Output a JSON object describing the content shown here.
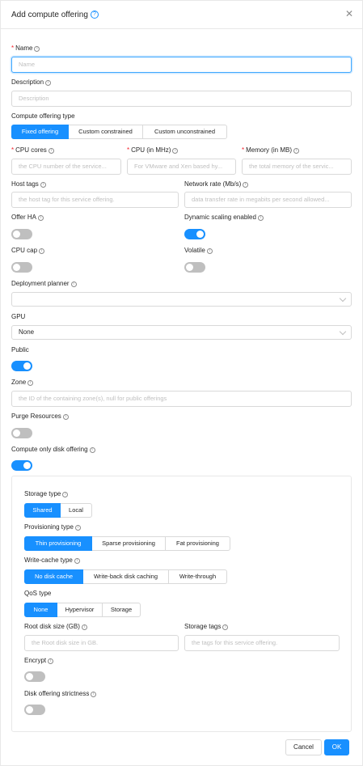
{
  "dialog": {
    "title": "Add compute offering",
    "help_icon": "question-circle-icon",
    "close_icon": "close-icon"
  },
  "fields": {
    "name": {
      "label": "Name",
      "placeholder": "Name",
      "required": true
    },
    "description": {
      "label": "Description",
      "placeholder": "Description"
    },
    "offering_type": {
      "label": "Compute offering type",
      "options": [
        "Fixed offering",
        "Custom constrained",
        "Custom unconstrained"
      ],
      "selected": "Fixed offering"
    },
    "cpu_cores": {
      "label": "CPU cores",
      "placeholder": "the CPU number of the service...",
      "required": true
    },
    "cpu_mhz": {
      "label": "CPU (in MHz)",
      "placeholder": "For VMware and Xen based hy...",
      "required": true
    },
    "memory": {
      "label": "Memory (in MB)",
      "placeholder": "the total memory of the servic...",
      "required": true
    },
    "host_tags": {
      "label": "Host tags",
      "placeholder": "the host tag for this service offering."
    },
    "network_rate": {
      "label": "Network rate (Mb/s)",
      "placeholder": "data transfer rate in megabits per second allowed..."
    },
    "offer_ha": {
      "label": "Offer HA",
      "on": false
    },
    "dynamic_scaling": {
      "label": "Dynamic scaling enabled",
      "on": true
    },
    "cpu_cap": {
      "label": "CPU cap",
      "on": false
    },
    "volatile": {
      "label": "Volatile",
      "on": false
    },
    "deployment_planner": {
      "label": "Deployment planner",
      "value": ""
    },
    "gpu": {
      "label": "GPU",
      "value": "None"
    },
    "public": {
      "label": "Public",
      "on": true
    },
    "zone": {
      "label": "Zone",
      "placeholder": "the ID of the containing zone(s), null for public offerings"
    },
    "purge_resources": {
      "label": "Purge Resources",
      "on": false
    },
    "compute_only_disk": {
      "label": "Compute only disk offering",
      "on": true
    }
  },
  "disk_panel": {
    "storage_type": {
      "label": "Storage type",
      "options": [
        "Shared",
        "Local"
      ],
      "selected": "Shared"
    },
    "provisioning_type": {
      "label": "Provisioning type",
      "options": [
        "Thin provisioning",
        "Sparse provisioning",
        "Fat provisioning"
      ],
      "selected": "Thin provisioning"
    },
    "write_cache_type": {
      "label": "Write-cache type",
      "options": [
        "No disk cache",
        "Write-back disk caching",
        "Write-through"
      ],
      "selected": "No disk cache"
    },
    "qos_type": {
      "label": "QoS type",
      "options": [
        "None",
        "Hypervisor",
        "Storage"
      ],
      "selected": "None"
    },
    "root_disk_size": {
      "label": "Root disk size (GB)",
      "placeholder": "the Root disk size in GB."
    },
    "storage_tags": {
      "label": "Storage tags",
      "placeholder": "the tags for this service offering."
    },
    "encrypt": {
      "label": "Encrypt",
      "on": false
    },
    "disk_strictness": {
      "label": "Disk offering strictness",
      "on": false
    }
  },
  "footer": {
    "cancel_label": "Cancel",
    "ok_label": "OK"
  },
  "colors": {
    "accent": "#1890ff",
    "required": "#f5222d",
    "toggle_off": "#bfbfbf",
    "border": "#d9d9d9"
  },
  "icons": {
    "info": "info-circle-icon",
    "dropdown": "chevron-down-icon"
  }
}
